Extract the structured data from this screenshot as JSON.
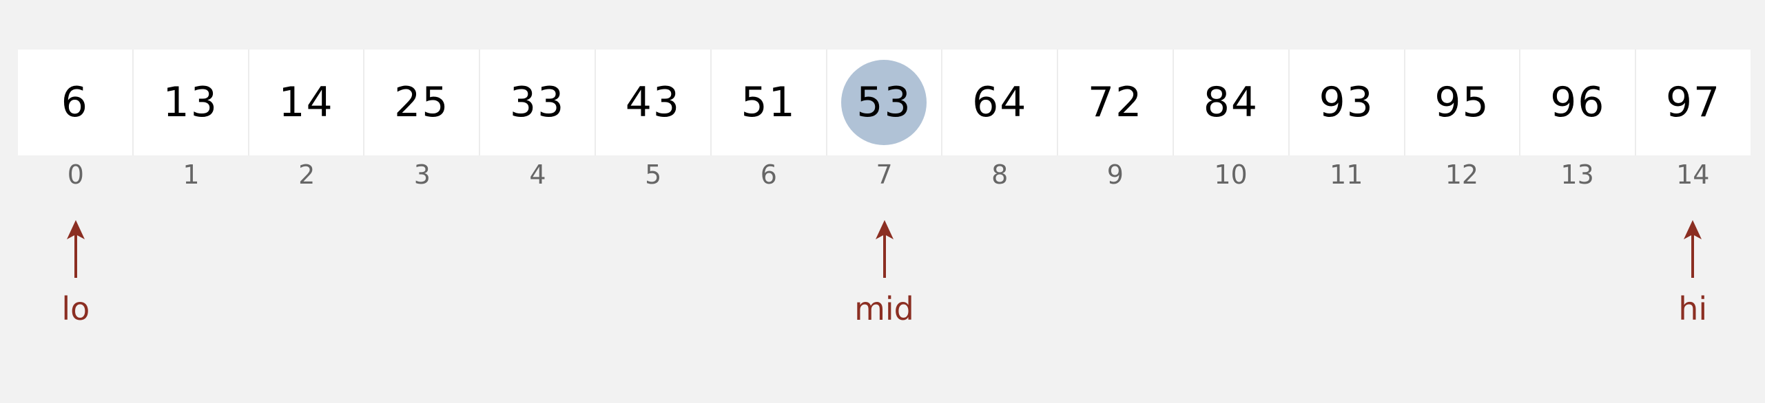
{
  "array": {
    "values": [
      "6",
      "13",
      "14",
      "25",
      "33",
      "43",
      "51",
      "53",
      "64",
      "72",
      "84",
      "93",
      "95",
      "96",
      "97"
    ],
    "indices": [
      "0",
      "1",
      "2",
      "3",
      "4",
      "5",
      "6",
      "7",
      "8",
      "9",
      "10",
      "11",
      "12",
      "13",
      "14"
    ],
    "highlighted_index": 7
  },
  "pointers": [
    {
      "label": "lo",
      "index": 0
    },
    {
      "label": "mid",
      "index": 7
    },
    {
      "label": "hi",
      "index": 14
    }
  ],
  "colors": {
    "highlight": "#b0c2d6",
    "pointer": "#8b2e22",
    "cell_background": "#ffffff",
    "index_text": "#666666",
    "page_background": "#f2f2f2"
  }
}
